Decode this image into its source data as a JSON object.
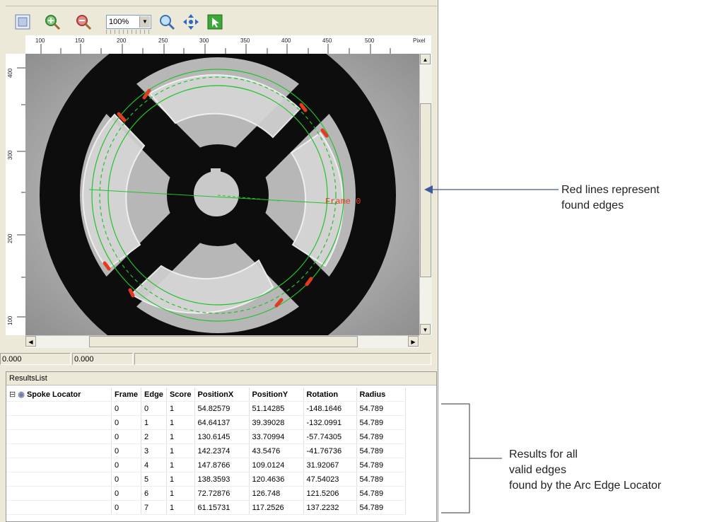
{
  "toolbar": {
    "zoom_value": "100%",
    "buttons": [
      "fit-icon",
      "zoom-in-icon",
      "zoom-out-icon",
      "magnify-icon",
      "pan-icon",
      "select-icon"
    ]
  },
  "ruler": {
    "horizontal": [
      "100",
      "150",
      "200",
      "250",
      "300",
      "350",
      "400",
      "450",
      "500",
      "Pixel"
    ],
    "vertical": [
      "400",
      "300",
      "200",
      "100"
    ]
  },
  "overlay": {
    "frame_label": "Frame 0"
  },
  "coords": {
    "x": "0.000",
    "y": "0.000"
  },
  "results": {
    "title": "ResultsList",
    "tool": "Spoke Locator",
    "headers": [
      "Frame",
      "Edge",
      "Score",
      "PositionX",
      "PositionY",
      "Rotation",
      "Radius"
    ],
    "rows": [
      [
        "0",
        "0",
        "1",
        "54.82579",
        "51.14285",
        "-148.1646",
        "54.789"
      ],
      [
        "0",
        "1",
        "1",
        "64.64137",
        "39.39028",
        "-132.0991",
        "54.789"
      ],
      [
        "0",
        "2",
        "1",
        "130.6145",
        "33.70994",
        "-57.74305",
        "54.789"
      ],
      [
        "0",
        "3",
        "1",
        "142.2374",
        "43.5476",
        "-41.76736",
        "54.789"
      ],
      [
        "0",
        "4",
        "1",
        "147.8766",
        "109.0124",
        "31.92067",
        "54.789"
      ],
      [
        "0",
        "5",
        "1",
        "138.3593",
        "120.4636",
        "47.54023",
        "54.789"
      ],
      [
        "0",
        "6",
        "1",
        "72.72876",
        "126.748",
        "121.5206",
        "54.789"
      ],
      [
        "0",
        "7",
        "1",
        "61.15731",
        "117.2526",
        "137.2232",
        "54.789"
      ]
    ]
  },
  "annotations": {
    "edges_line1": "Red lines represent",
    "edges_line2": "found edges",
    "results_line1": "Results for all",
    "results_line2": "valid edges",
    "results_line3": "found by the Arc Edge Locator"
  },
  "colors": {
    "found_edge": "#e23b1f",
    "locator": "#22c22a",
    "annotation_arrow": "#3b5b9b"
  }
}
